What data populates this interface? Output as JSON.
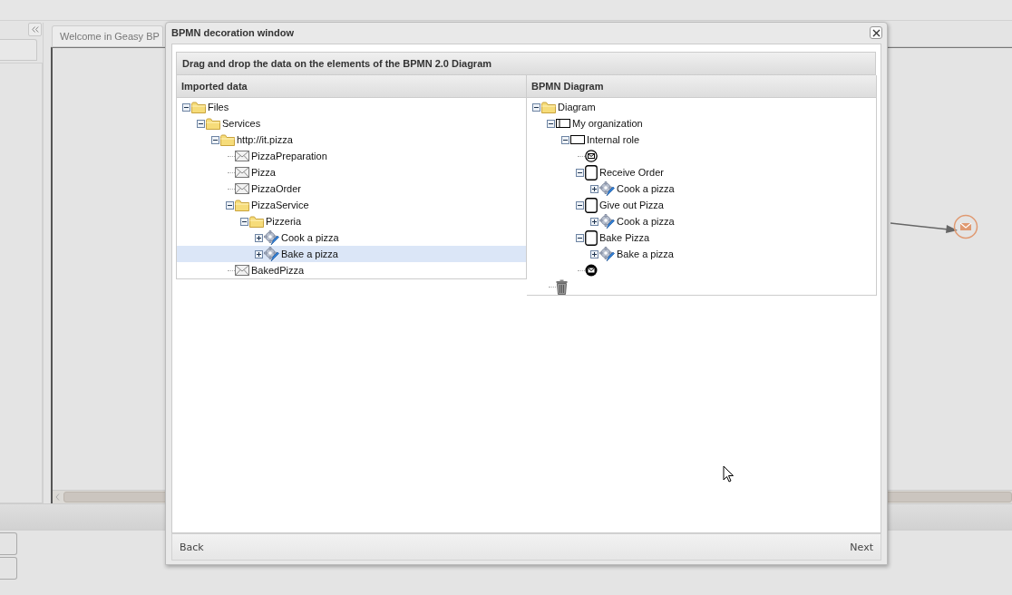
{
  "background_app": {
    "tab": {
      "label": "Welcome in Geasy BP",
      "selected": true
    }
  },
  "window": {
    "title": "BPMN decoration window"
  },
  "instruction": "Drag and drop the data on the elements of the BPMN 2.0 Diagram",
  "imported_panel": {
    "title": "Imported data",
    "tree": [
      {
        "label": "Files",
        "kind": "folder",
        "expanded": true,
        "selected": false,
        "children": [
          {
            "label": "Services",
            "kind": "folder",
            "expanded": true,
            "selected": false,
            "children": [
              {
                "label": "http://it.pizza",
                "kind": "folder",
                "expanded": true,
                "selected": false,
                "children": [
                  {
                    "label": "PizzaPreparation",
                    "kind": "message",
                    "selected": false
                  },
                  {
                    "label": "Pizza",
                    "kind": "message",
                    "selected": false
                  },
                  {
                    "label": "PizzaOrder",
                    "kind": "message",
                    "selected": false
                  },
                  {
                    "label": "PizzaService",
                    "kind": "folder",
                    "expanded": true,
                    "selected": false,
                    "children": [
                      {
                        "label": "Pizzeria",
                        "kind": "folder",
                        "expanded": true,
                        "selected": false,
                        "children": [
                          {
                            "label": "Cook a pizza",
                            "kind": "service",
                            "expanded": false,
                            "selected": false
                          },
                          {
                            "label": "Bake a pizza",
                            "kind": "service",
                            "expanded": false,
                            "selected": true
                          }
                        ]
                      }
                    ]
                  },
                  {
                    "label": "BakedPizza",
                    "kind": "message",
                    "selected": false
                  }
                ]
              }
            ]
          }
        ]
      }
    ]
  },
  "diagram_panel": {
    "title": "BPMN Diagram",
    "tree": [
      {
        "label": "Diagram",
        "kind": "folder",
        "expanded": true,
        "selected": false,
        "children": [
          {
            "label": "My organization",
            "kind": "pool",
            "expanded": true,
            "selected": false,
            "children": [
              {
                "label": "Internal role",
                "kind": "lane",
                "expanded": true,
                "selected": false,
                "children": [
                  {
                    "kind": "start-event",
                    "selected": false
                  },
                  {
                    "label": "Receive Order",
                    "kind": "task",
                    "expanded": true,
                    "selected": false,
                    "children": [
                      {
                        "label": "Cook a pizza",
                        "kind": "service",
                        "expanded": false,
                        "selected": false
                      }
                    ]
                  },
                  {
                    "label": "Give out Pizza",
                    "kind": "task",
                    "expanded": true,
                    "selected": false,
                    "children": [
                      {
                        "label": "Cook a pizza",
                        "kind": "service",
                        "expanded": false,
                        "selected": false
                      }
                    ]
                  },
                  {
                    "label": "Bake Pizza",
                    "kind": "task",
                    "expanded": true,
                    "selected": false,
                    "children": [
                      {
                        "label": "Bake a pizza",
                        "kind": "service",
                        "expanded": false,
                        "selected": false
                      }
                    ]
                  },
                  {
                    "kind": "end-event",
                    "selected": false
                  }
                ]
              }
            ]
          },
          {
            "kind": "trash",
            "selected": false
          }
        ]
      }
    ]
  },
  "footer": {
    "back": "Back",
    "next": "Next"
  }
}
